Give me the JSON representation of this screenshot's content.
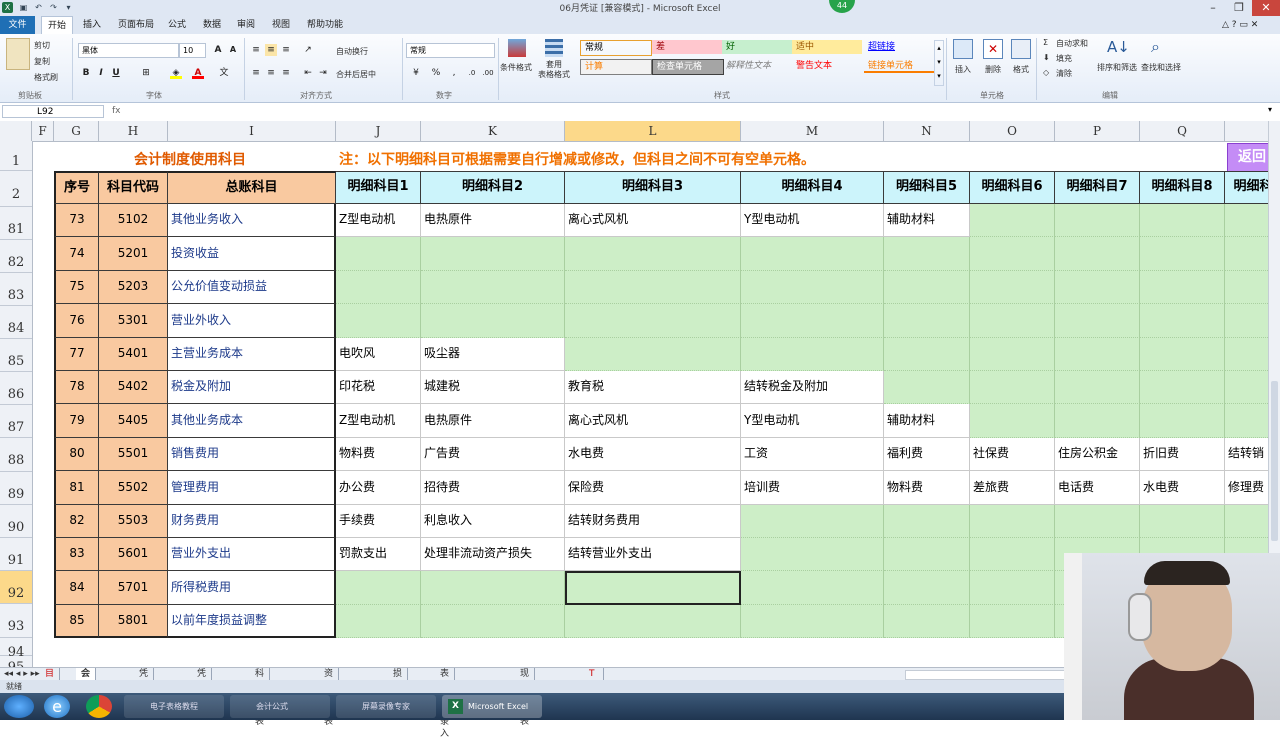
{
  "window": {
    "title": "06月凭证 [兼容模式] - Microsoft Excel",
    "notification_count": "44"
  },
  "ribbon_tabs": [
    "文件",
    "开始",
    "插入",
    "页面布局",
    "公式",
    "数据",
    "审阅",
    "视图",
    "帮助功能"
  ],
  "ribbon": {
    "clipboard": {
      "cut": "剪切",
      "copy": "复制",
      "format_painter": "格式刷",
      "group": "剪贴板"
    },
    "font": {
      "name": "黑体",
      "size": "10",
      "group": "字体"
    },
    "alignment": {
      "wrap": "自动换行",
      "merge": "合并后居中",
      "group": "对齐方式"
    },
    "number": {
      "format": "常规",
      "group": "数字"
    },
    "styles": {
      "conditional": "条件格式",
      "table": "套用\n表格格式",
      "items": [
        {
          "label": "常规",
          "bg": "#ffffff",
          "fg": "#000000"
        },
        {
          "label": "差",
          "bg": "#ffc7ce",
          "fg": "#9c0006"
        },
        {
          "label": "好",
          "bg": "#c6efce",
          "fg": "#006100"
        },
        {
          "label": "适中",
          "bg": "#ffeb9c",
          "fg": "#9c5700"
        },
        {
          "label": "超链接",
          "bg": "#ffffff",
          "fg": "#0000ff"
        },
        {
          "label": "计算",
          "bg": "#f2f2f2",
          "fg": "#fa7d00"
        },
        {
          "label": "检查单元格",
          "bg": "#a5a5a5",
          "fg": "#ffffff"
        },
        {
          "label": "解释性文本",
          "bg": "#ffffff",
          "fg": "#7f7f7f"
        },
        {
          "label": "警告文本",
          "bg": "#ffffff",
          "fg": "#ff0000"
        },
        {
          "label": "链接单元格",
          "bg": "#ffffff",
          "fg": "#fa7d00"
        }
      ],
      "group": "样式"
    },
    "cells": {
      "insert": "插入",
      "delete": "删除",
      "format": "格式",
      "group": "单元格"
    },
    "editing": {
      "autosum": "自动求和",
      "fill": "填充",
      "clear": "清除",
      "sort": "排序和筛选",
      "find": "查找和选择",
      "group": "编辑"
    }
  },
  "formula_bar": {
    "name_box": "L92",
    "content": ""
  },
  "columns": [
    "F",
    "G",
    "H",
    "I",
    "J",
    "K",
    "L",
    "M",
    "N",
    "O",
    "P",
    "Q"
  ],
  "row_numbers": [
    "1",
    "2",
    "81",
    "82",
    "83",
    "84",
    "85",
    "86",
    "87",
    "88",
    "89",
    "90",
    "91",
    "92",
    "93",
    "94",
    "95"
  ],
  "sheet": {
    "title": "会计制度使用科目",
    "note": "注：以下明细科目可根据需要自行增减或修改，但科目之间不可有空单元格。",
    "return_button": "返回",
    "headers": [
      "序号",
      "科目代码",
      "总账科目",
      "明细科目1",
      "明细科目2",
      "明细科目3",
      "明细科目4",
      "明细科目5",
      "明细科目6",
      "明细科目7",
      "明细科目8",
      "明细科"
    ],
    "rows": [
      {
        "seq": "73",
        "code": "5102",
        "account": "其他业务收入",
        "details": [
          "Z型电动机",
          "电热原件",
          "离心式风机",
          "Y型电动机",
          "辅助材料",
          "",
          "",
          "",
          ""
        ]
      },
      {
        "seq": "74",
        "code": "5201",
        "account": "投资收益",
        "details": [
          "",
          "",
          "",
          "",
          "",
          "",
          "",
          "",
          ""
        ]
      },
      {
        "seq": "75",
        "code": "5203",
        "account": "公允价值变动损益",
        "details": [
          "",
          "",
          "",
          "",
          "",
          "",
          "",
          "",
          ""
        ]
      },
      {
        "seq": "76",
        "code": "5301",
        "account": "营业外收入",
        "details": [
          "",
          "",
          "",
          "",
          "",
          "",
          "",
          "",
          ""
        ]
      },
      {
        "seq": "77",
        "code": "5401",
        "account": "主营业务成本",
        "details": [
          "电吹风",
          "吸尘器",
          "",
          "",
          "",
          "",
          "",
          "",
          ""
        ]
      },
      {
        "seq": "78",
        "code": "5402",
        "account": "税金及附加",
        "details": [
          "印花税",
          "城建税",
          "教育税",
          "结转税金及附加",
          "",
          "",
          "",
          "",
          ""
        ]
      },
      {
        "seq": "79",
        "code": "5405",
        "account": "其他业务成本",
        "details": [
          "Z型电动机",
          "电热原件",
          "离心式风机",
          "Y型电动机",
          "辅助材料",
          "",
          "",
          "",
          ""
        ]
      },
      {
        "seq": "80",
        "code": "5501",
        "account": "销售费用",
        "details": [
          "物料费",
          "广告费",
          "水电费",
          "工资",
          "福利费",
          "社保费",
          "住房公积金",
          "折旧费",
          "结转销"
        ]
      },
      {
        "seq": "81",
        "code": "5502",
        "account": "管理费用",
        "details": [
          "办公费",
          "招待费",
          "保险费",
          "培训费",
          "物料费",
          "差旅费",
          "电话费",
          "水电费",
          "修理费"
        ]
      },
      {
        "seq": "82",
        "code": "5503",
        "account": "财务费用",
        "details": [
          "手续费",
          "利息收入",
          "结转财务费用",
          "",
          "",
          "",
          "",
          "",
          ""
        ]
      },
      {
        "seq": "83",
        "code": "5601",
        "account": "营业外支出",
        "details": [
          "罚款支出",
          "处理非流动资产损失",
          "结转营业外支出",
          "",
          "",
          "",
          "",
          "",
          ""
        ]
      },
      {
        "seq": "84",
        "code": "5701",
        "account": "所得税费用",
        "details": [
          "",
          "",
          "",
          "",
          "",
          "",
          "",
          "",
          ""
        ]
      },
      {
        "seq": "85",
        "code": "5801",
        "account": "以前年度损益调整",
        "details": [
          "",
          "",
          "",
          "",
          "",
          "",
          "",
          "",
          ""
        ]
      }
    ]
  },
  "sheet_tabs": [
    "目录",
    "会计科目",
    "凭证录入",
    "凭证打印",
    "科目余额表",
    "资产负债表",
    "损益表",
    "表外数据录入",
    "现金流量表",
    "T字账"
  ],
  "active_sheet_tab": "会计科目",
  "status": "就绪",
  "taskbar": {
    "items": [
      "电子表格教程",
      "会计公式",
      "屏幕录像专家",
      "Microsoft Excel"
    ]
  },
  "colors": {
    "orange": "#f9c9a0",
    "green": "#cdeec7",
    "header_blue": "#ccf4fb",
    "title_orange": "#e05a00",
    "note_orange": "#f07000",
    "purple": "#a040e8"
  }
}
